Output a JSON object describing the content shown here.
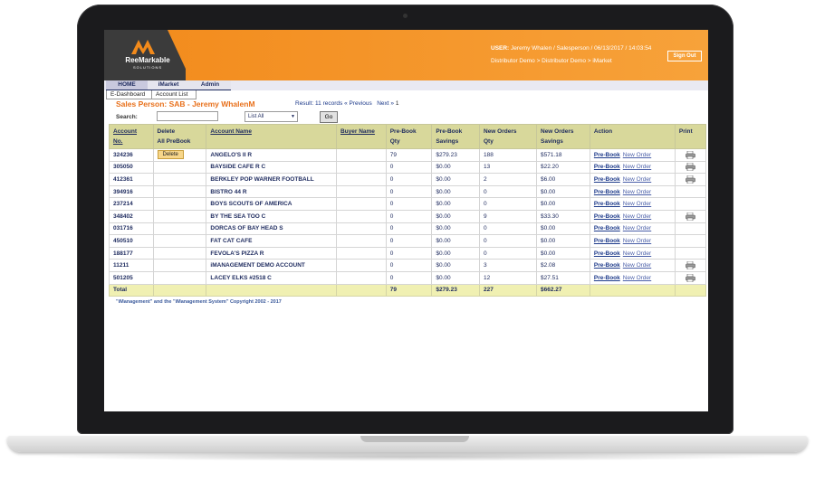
{
  "brand": {
    "name": "ReeMarkable",
    "subtitle": "SOLUTIONS",
    "accent": "#f28a1b"
  },
  "header": {
    "user_label": "USER:",
    "user_info": "Jeremy Whalen / Salesperson / 06/13/2017 / 14:03:54",
    "breadcrumb": "Distributor Demo > Distributor Demo > iMarket",
    "signout_label": "Sign Out"
  },
  "tabs": [
    "HOME",
    "iMarket",
    "Admin"
  ],
  "subtabs": [
    "E-Dashboard",
    "Account List"
  ],
  "page": {
    "salesperson_title": "Sales Person: SAB - Jeremy WhalenM",
    "result_text": "Result: 11 records",
    "prev_label": "« Previous",
    "next_label": "Next »",
    "page_number": "1"
  },
  "search": {
    "label": "Search:",
    "value": "",
    "select_value": "List All",
    "go_label": "Go"
  },
  "table": {
    "headers": {
      "account_no_1": "Account",
      "account_no_2": "No.",
      "delete_1": "Delete",
      "delete_2": "All PreBook",
      "account_name": "Account Name",
      "buyer_name": "Buyer Name",
      "prebook_qty_1": "Pre-Book",
      "prebook_qty_2": "Qty",
      "prebook_sav_1": "Pre-Book",
      "prebook_sav_2": "Savings",
      "neworders_qty_1": "New Orders",
      "neworders_qty_2": "Qty",
      "neworders_sav_1": "New Orders",
      "neworders_sav_2": "Savings",
      "action": "Action",
      "print": "Print"
    },
    "delete_label": "Delete",
    "prebook_label": "Pre-Book",
    "neworder_label": "New Order",
    "rows": [
      {
        "no": "324236",
        "name": "ANGELO'S II R",
        "pb_qty": "79",
        "pb_sav": "$279.23",
        "no_qty": "188",
        "no_sav": "$571.18",
        "delete": true,
        "print": true
      },
      {
        "no": "305050",
        "name": "BAYSIDE CAFE R C",
        "pb_qty": "0",
        "pb_sav": "$0.00",
        "no_qty": "13",
        "no_sav": "$22.20",
        "delete": false,
        "print": true
      },
      {
        "no": "412361",
        "name": "BERKLEY POP WARNER FOOTBALL",
        "pb_qty": "0",
        "pb_sav": "$0.00",
        "no_qty": "2",
        "no_sav": "$6.00",
        "delete": false,
        "print": true
      },
      {
        "no": "394916",
        "name": "BISTRO 44 R",
        "pb_qty": "0",
        "pb_sav": "$0.00",
        "no_qty": "0",
        "no_sav": "$0.00",
        "delete": false,
        "print": false
      },
      {
        "no": "237214",
        "name": "BOYS SCOUTS OF AMERICA",
        "pb_qty": "0",
        "pb_sav": "$0.00",
        "no_qty": "0",
        "no_sav": "$0.00",
        "delete": false,
        "print": false
      },
      {
        "no": "348402",
        "name": "BY THE SEA TOO C",
        "pb_qty": "0",
        "pb_sav": "$0.00",
        "no_qty": "9",
        "no_sav": "$33.30",
        "delete": false,
        "print": true
      },
      {
        "no": "031716",
        "name": "DORCAS OF BAY HEAD S",
        "pb_qty": "0",
        "pb_sav": "$0.00",
        "no_qty": "0",
        "no_sav": "$0.00",
        "delete": false,
        "print": false
      },
      {
        "no": "450510",
        "name": "FAT CAT CAFE",
        "pb_qty": "0",
        "pb_sav": "$0.00",
        "no_qty": "0",
        "no_sav": "$0.00",
        "delete": false,
        "print": false
      },
      {
        "no": "188177",
        "name": "FEVOLA'S PIZZA R",
        "pb_qty": "0",
        "pb_sav": "$0.00",
        "no_qty": "0",
        "no_sav": "$0.00",
        "delete": false,
        "print": false
      },
      {
        "no": "11211",
        "name": "iMANAGEMENT DEMO ACCOUNT",
        "pb_qty": "0",
        "pb_sav": "$0.00",
        "no_qty": "3",
        "no_sav": "$2.08",
        "delete": false,
        "print": true
      },
      {
        "no": "501205",
        "name": "LACEY ELKS #2518 C",
        "pb_qty": "0",
        "pb_sav": "$0.00",
        "no_qty": "12",
        "no_sav": "$27.51",
        "delete": false,
        "print": true
      }
    ],
    "total": {
      "label": "Total",
      "pb_qty": "79",
      "pb_sav": "$279.23",
      "no_qty": "227",
      "no_sav": "$662.27"
    }
  },
  "footer": {
    "copyright": "\"iManagement\" and the \"iManagement System\" Copyright 2002 - 2017"
  }
}
